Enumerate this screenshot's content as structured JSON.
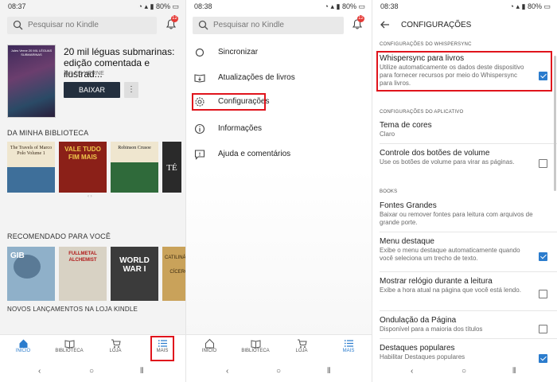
{
  "colors": {
    "accent": "#2b7ccd",
    "highlight": "#e0141c",
    "primary_button": "#232f3e",
    "badge": "#e53935"
  },
  "panel1": {
    "status": {
      "time": "08:37",
      "battery": "80%"
    },
    "search": {
      "placeholder": "Pesquisar no Kindle"
    },
    "notif_count": "12",
    "hero": {
      "title": "20 mil léguas submarinas: edição comentada e ilustrad...",
      "author": "JULES VERNE",
      "download": "BAIXAR",
      "more": "⋮",
      "cover_text": "Jules Verne 20 MIL LÉGUAS SUBMARINAS"
    },
    "library_heading": "DA MINHA BIBLIOTECA",
    "library_books": [
      {
        "title": "The Travels of Marco Polo Volume 1",
        "color": "#3e6f9a",
        "text_color": "#3a2a1a"
      },
      {
        "title": "VALE TUDO FIM MAIS",
        "color": "#8b2018",
        "text_color": "#f2c94c"
      },
      {
        "title": "Robinson Crusoe",
        "color": "#2f6a3a",
        "text_color": "#1a1a1a"
      },
      {
        "title": "TÉ",
        "color": "#2a2a2a",
        "text_color": "#ffffff"
      }
    ],
    "recommend_heading": "RECOMENDADO PARA VOCÊ",
    "recommend_books": [
      {
        "title": "",
        "color": "#8fb0c9"
      },
      {
        "title": "FULLMETAL ALCHEMIST",
        "color": "#d8d2c4"
      },
      {
        "title": "WORLD WAR I",
        "color": "#3b3b3b"
      },
      {
        "title": "CATILINÁRIAS CÍCERO",
        "color": "#c9a25a"
      }
    ],
    "new_heading": "NOVOS LANÇAMENTOS NA LOJA KINDLE",
    "nav": [
      "INÍCIO",
      "BIBLIOTECA",
      "LOJA",
      "MAIS"
    ]
  },
  "panel2": {
    "status": {
      "time": "08:38",
      "battery": "80%"
    },
    "search": {
      "placeholder": "Pesquisar no Kindle"
    },
    "notif_count": "12",
    "menu": [
      {
        "label": "Sincronizar",
        "icon": "sync-icon"
      },
      {
        "label": "Atualizações de livros",
        "icon": "book-update-icon"
      },
      {
        "label": "Configurações",
        "icon": "gear-icon"
      },
      {
        "label": "Informações",
        "icon": "info-icon"
      },
      {
        "label": "Ajuda e comentários",
        "icon": "help-icon"
      }
    ],
    "nav": [
      "INÍCIO",
      "BIBLIOTECA",
      "LOJA",
      "MAIS"
    ]
  },
  "panel3": {
    "status": {
      "time": "08:38",
      "battery": "80%"
    },
    "title": "CONFIGURAÇÕES",
    "groups": {
      "whispersync": "CONFIGURAÇÕES DO WHISPERSYNC",
      "app": "CONFIGURAÇÕES DO APLICATIVO",
      "books": "BOOKS"
    },
    "settings": [
      {
        "title": "Whispersync para livros",
        "desc": "Utilize automaticamente os dados deste dispositivo para fornecer recursos por meio do Whispersync para livros.",
        "checked": true
      },
      {
        "title": "Tema de cores",
        "desc": "Claro"
      },
      {
        "title": "Controle dos botões de volume",
        "desc": "Use os botões de volume para virar as páginas.",
        "checked": false
      },
      {
        "title": "Fontes Grandes",
        "desc": "Baixar ou remover fontes para leitura com arquivos de grande porte."
      },
      {
        "title": "Menu destaque",
        "desc": "Exibe o menu destaque automaticamente quando você seleciona um trecho de texto.",
        "checked": true
      },
      {
        "title": "Mostrar relógio durante a leitura",
        "desc": "Exibe a hora atual na página que você está lendo.",
        "checked": false
      },
      {
        "title": "Ondulação da Página",
        "desc": "Disponível para a maioria dos títulos",
        "checked": false
      },
      {
        "title": "Destaques populares",
        "desc": "Habilitar Destaques populares",
        "checked": true
      }
    ]
  }
}
